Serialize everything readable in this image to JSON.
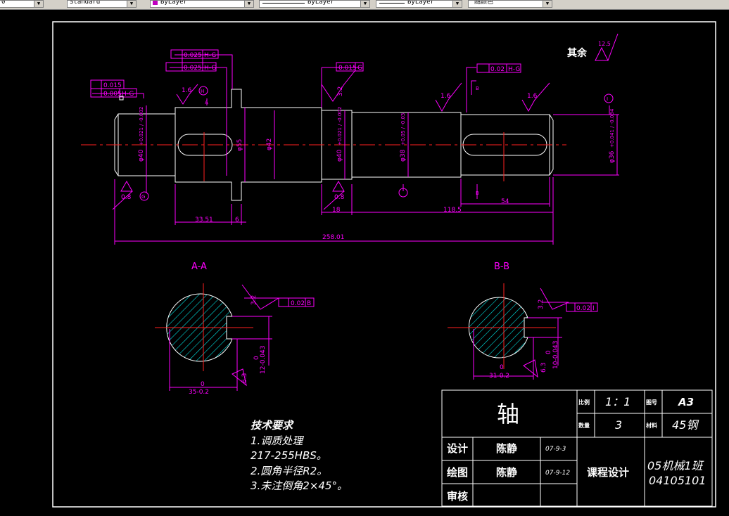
{
  "toolbar": {
    "first_value": "0",
    "text_style": "Standard",
    "layer_color": "ByLayer",
    "linetype": "ByLayer",
    "lineweight": "ByLayer",
    "plot_style": "随颜色"
  },
  "drawing": {
    "surface_finish": {
      "label": "其余",
      "value": "12.5"
    },
    "roughness": {
      "r16_a": "1.6",
      "r16_b": "1.6",
      "r16_c": "1.6",
      "r32": "3.2",
      "r08_a": "0.8",
      "r08_b": "0.8"
    },
    "tolerances": {
      "t1": "0.025",
      "t1_ref": "H-G",
      "t2": "0.025",
      "t2_ref": "H-G",
      "t3": "0.015",
      "t4": "0.005",
      "t4_ref": "H-G",
      "t5": "0.015",
      "t5_ref": "G",
      "t6": "0.02",
      "t6_ref": "H-G"
    },
    "datum": {
      "d1": "H",
      "d2": "G",
      "d3": "I"
    },
    "diameters": {
      "d40a": "φ40",
      "d40a_tol": "+0.021 / -0.002",
      "d55": "φ55",
      "d42": "φ42",
      "d40b": "φ40",
      "d40b_tol": "+0.021 / -0.002",
      "d38": "φ38",
      "d38_tol": "+0.05 / -0.03",
      "d36": "φ36",
      "d36_tol": "+0.041 / -0.034"
    },
    "lengths": {
      "l1": "33.51",
      "l2": "6",
      "l3": "18",
      "l4": "118.5",
      "l5": "54",
      "l6": "258.01"
    },
    "section_labels": {
      "a": "A-A",
      "b": "B-B"
    },
    "section_a": {
      "roughness": "3.2",
      "tol": "0.02",
      "tol_ref": "B",
      "depth": "12-0.043",
      "depth_top": "0",
      "width": "35-0.2",
      "width_top": "0",
      "bottom_roughness": "6.3"
    },
    "section_b": {
      "roughness": "3.2",
      "tol": "0.02",
      "tol_ref": "I",
      "depth": "10-0.043",
      "depth_top": "0",
      "width": "31-0.2",
      "width_top": "0",
      "bottom_roughness": "6.3"
    },
    "section_letter_a": "A",
    "section_letter_b": "B",
    "tech_req": {
      "title": "技术要求",
      "line1": "1.调质处理",
      "line2": "217-255HBS。",
      "line3": "2.圆角半径R2。",
      "line4": "3.未注倒角2×45°。"
    }
  },
  "title_block": {
    "part_name": "轴",
    "scale_label": "比例",
    "scale_value": "1：1",
    "sheet_label": "图号",
    "sheet_value": "A3",
    "qty_label": "数量",
    "qty_value": "3",
    "material_label": "材料",
    "material_value": "45钢",
    "designer_label": "设计",
    "designer_name": "陈静",
    "designer_date": "07-9-3",
    "drafter_label": "绘图",
    "drafter_name": "陈静",
    "drafter_date": "07-9-12",
    "checker_label": "审核",
    "project": "课程设计",
    "class_name": "05机械1班",
    "student_id": "04105101"
  }
}
